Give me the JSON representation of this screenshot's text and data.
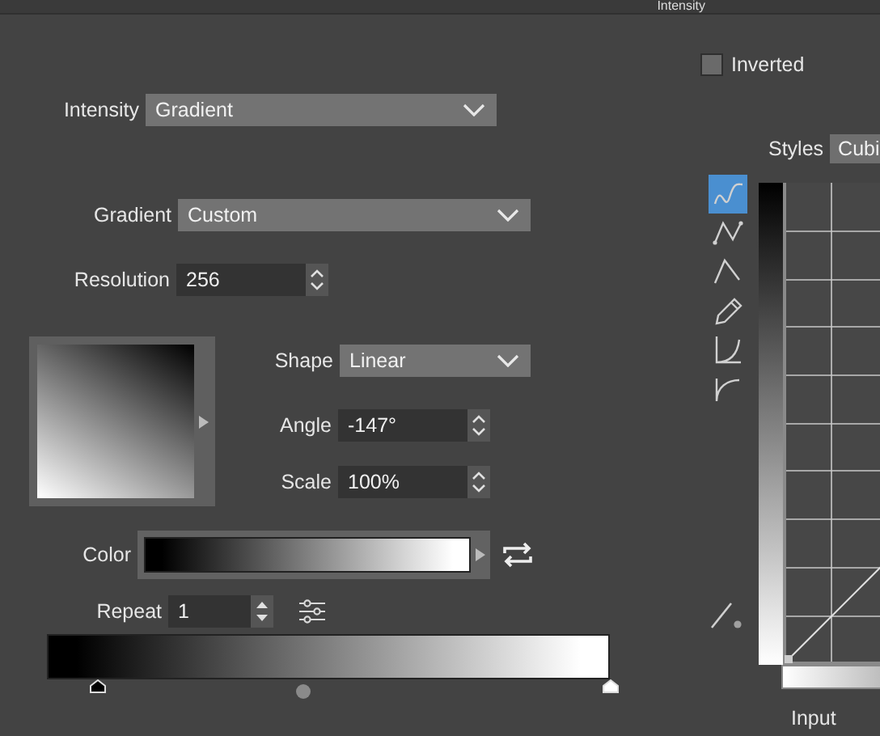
{
  "title": "Intensity",
  "inverted": {
    "label": "Inverted",
    "checked": false
  },
  "intensity": {
    "label": "Intensity",
    "value": "Gradient"
  },
  "styles": {
    "label": "Styles",
    "value": "Cubi"
  },
  "gradient": {
    "label": "Gradient",
    "value": "Custom"
  },
  "resolution": {
    "label": "Resolution",
    "value": "256"
  },
  "shape": {
    "label": "Shape",
    "value": "Linear"
  },
  "angle": {
    "label": "Angle",
    "value": "-147°"
  },
  "scale": {
    "label": "Scale",
    "value": "100%"
  },
  "color": {
    "label": "Color"
  },
  "repeat": {
    "label": "Repeat",
    "value": "1"
  },
  "stops": [
    {
      "color": "#000000"
    },
    {
      "color": "#ffffff"
    }
  ],
  "curve_tools": [
    {
      "kind": "smooth",
      "selected": true
    },
    {
      "kind": "polyline",
      "selected": false
    },
    {
      "kind": "peak",
      "selected": false
    },
    {
      "kind": "pencil",
      "selected": false
    },
    {
      "kind": "ease-in",
      "selected": false
    },
    {
      "kind": "ease-out",
      "selected": false
    }
  ],
  "input_label": "Input"
}
